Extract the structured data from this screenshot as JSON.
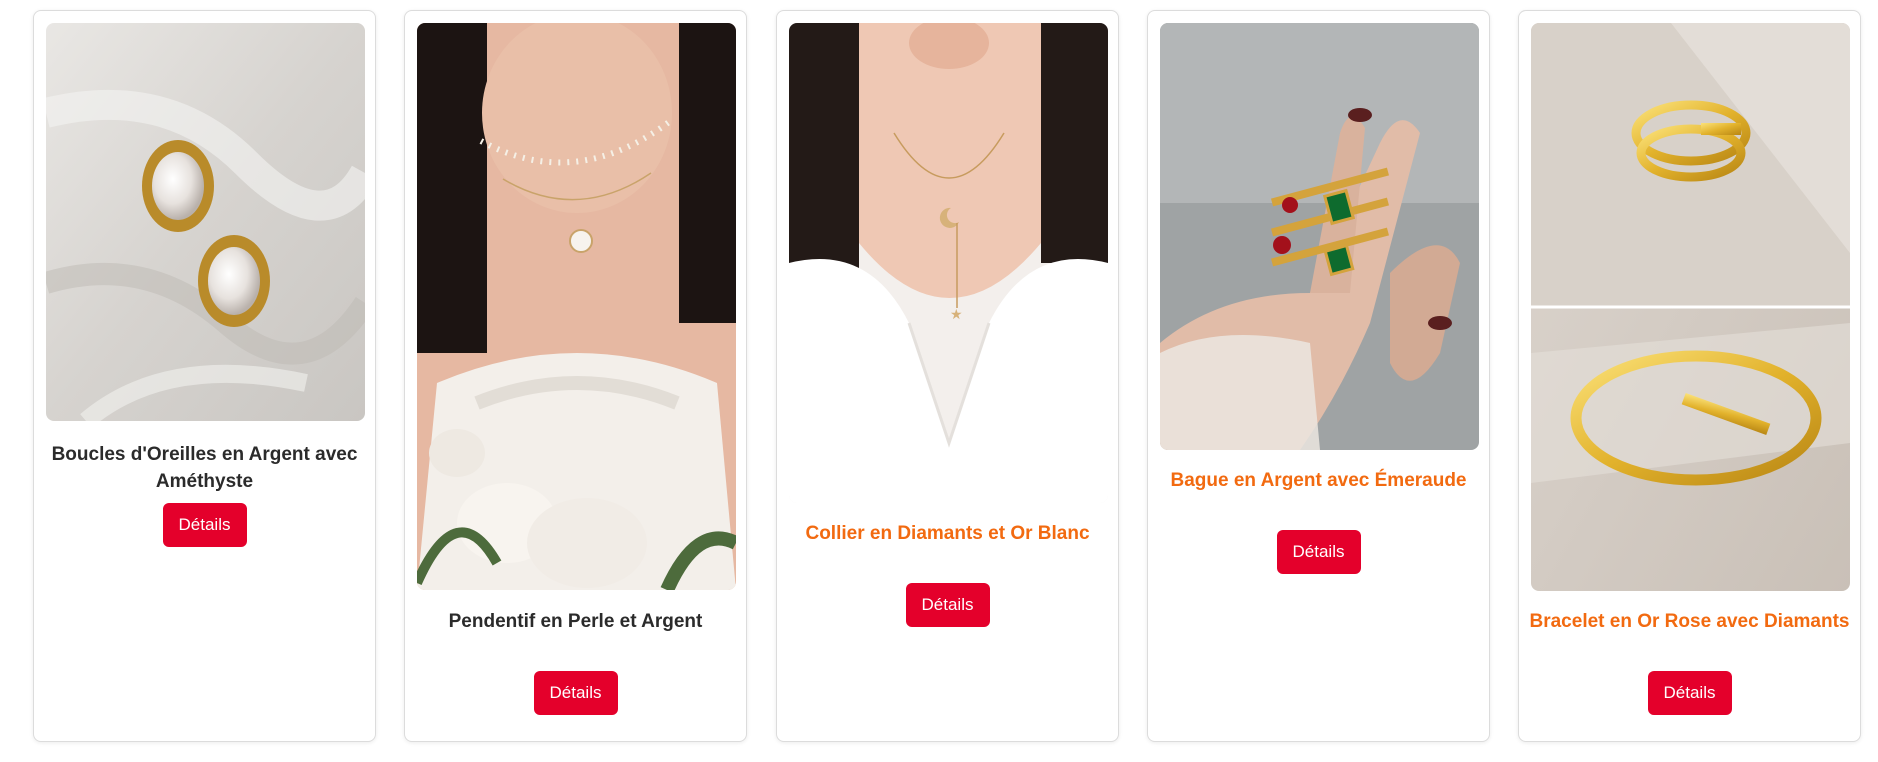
{
  "theme": {
    "button_color": "#e4002b",
    "title_dark": "#2b2b2b",
    "title_accent": "#f26a10"
  },
  "products": [
    {
      "title": "Boucles d'Oreilles en Argent avec Améthyste",
      "button": "Détails",
      "image_icon": "pearl-earrings-image",
      "title_style": "dark"
    },
    {
      "title": "Pendentif en Perle et Argent",
      "button": "Détails",
      "image_icon": "pearl-necklace-image",
      "title_style": "dark"
    },
    {
      "title": "Collier en Diamants et Or Blanc",
      "button": "Détails",
      "image_icon": "moon-necklace-image",
      "title_style": "accent"
    },
    {
      "title": "Bague en Argent avec Émeraude",
      "button": "Détails",
      "image_icon": "emerald-rings-image",
      "title_style": "accent"
    },
    {
      "title": "Bracelet en Or Rose avec Diamants",
      "button": "Détails",
      "image_icon": "gold-bracelet-image",
      "title_style": "accent"
    }
  ]
}
